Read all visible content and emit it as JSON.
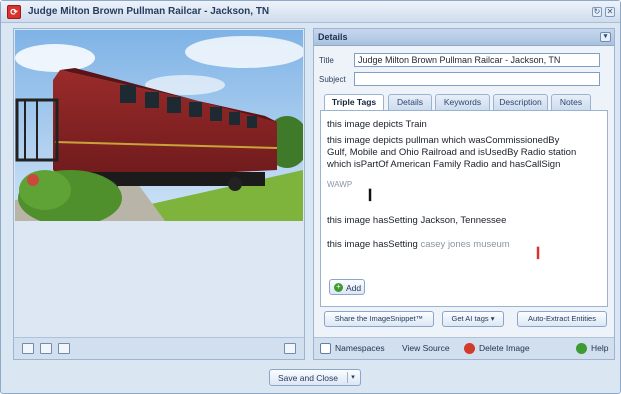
{
  "window": {
    "title": "Judge Milton Brown Pullman Railcar - Jackson, TN",
    "app_icon": "app-logo-icon",
    "controls": [
      "refresh-icon",
      "close-icon"
    ]
  },
  "left_pane": {
    "photo_icon": "railcar-photo",
    "bottom_icons": [
      "single-view-icon",
      "grid-view-icon",
      "filmstrip-icon",
      "expand-icon"
    ]
  },
  "details": {
    "header": "Details",
    "title_label": "Title",
    "title_value": "Judge Milton Brown Pullman Railcar - Jackson, TN",
    "subject_label": "Subject",
    "subject_value": "",
    "tabs": [
      "Triple Tags",
      "Details",
      "Keywords",
      "Description",
      "Notes"
    ],
    "active_tab": "Triple Tags",
    "tags": {
      "line1": "this image depicts Train",
      "line2a": "this image depicts pullman which wasCommissionedBy",
      "line2b": "Gulf, Mobile and Ohio Railroad and isUsedBy Radio station",
      "line2c": "which isPartOf American Family Radio and hasCallSign",
      "line2d": "WAWP",
      "line3": "this image hasSetting Jackson, Tennessee",
      "line4_prefix": "this image hasSetting",
      "line4_value": "casey jones museum"
    },
    "add_label": "Add",
    "actions": {
      "share": "Share the ImageSnippet™",
      "get_ai_tags": "Get AI tags",
      "auto_extract": "Auto-Extract Entities"
    },
    "footer": {
      "namespaces": "Namespaces",
      "view_source": "View Source",
      "delete_image": "Delete Image",
      "help": "Help"
    }
  },
  "save_close": "Save and Close",
  "colors": {
    "accent": "#d9332b",
    "delete": "#d23a2a",
    "help": "#3d9b32"
  }
}
